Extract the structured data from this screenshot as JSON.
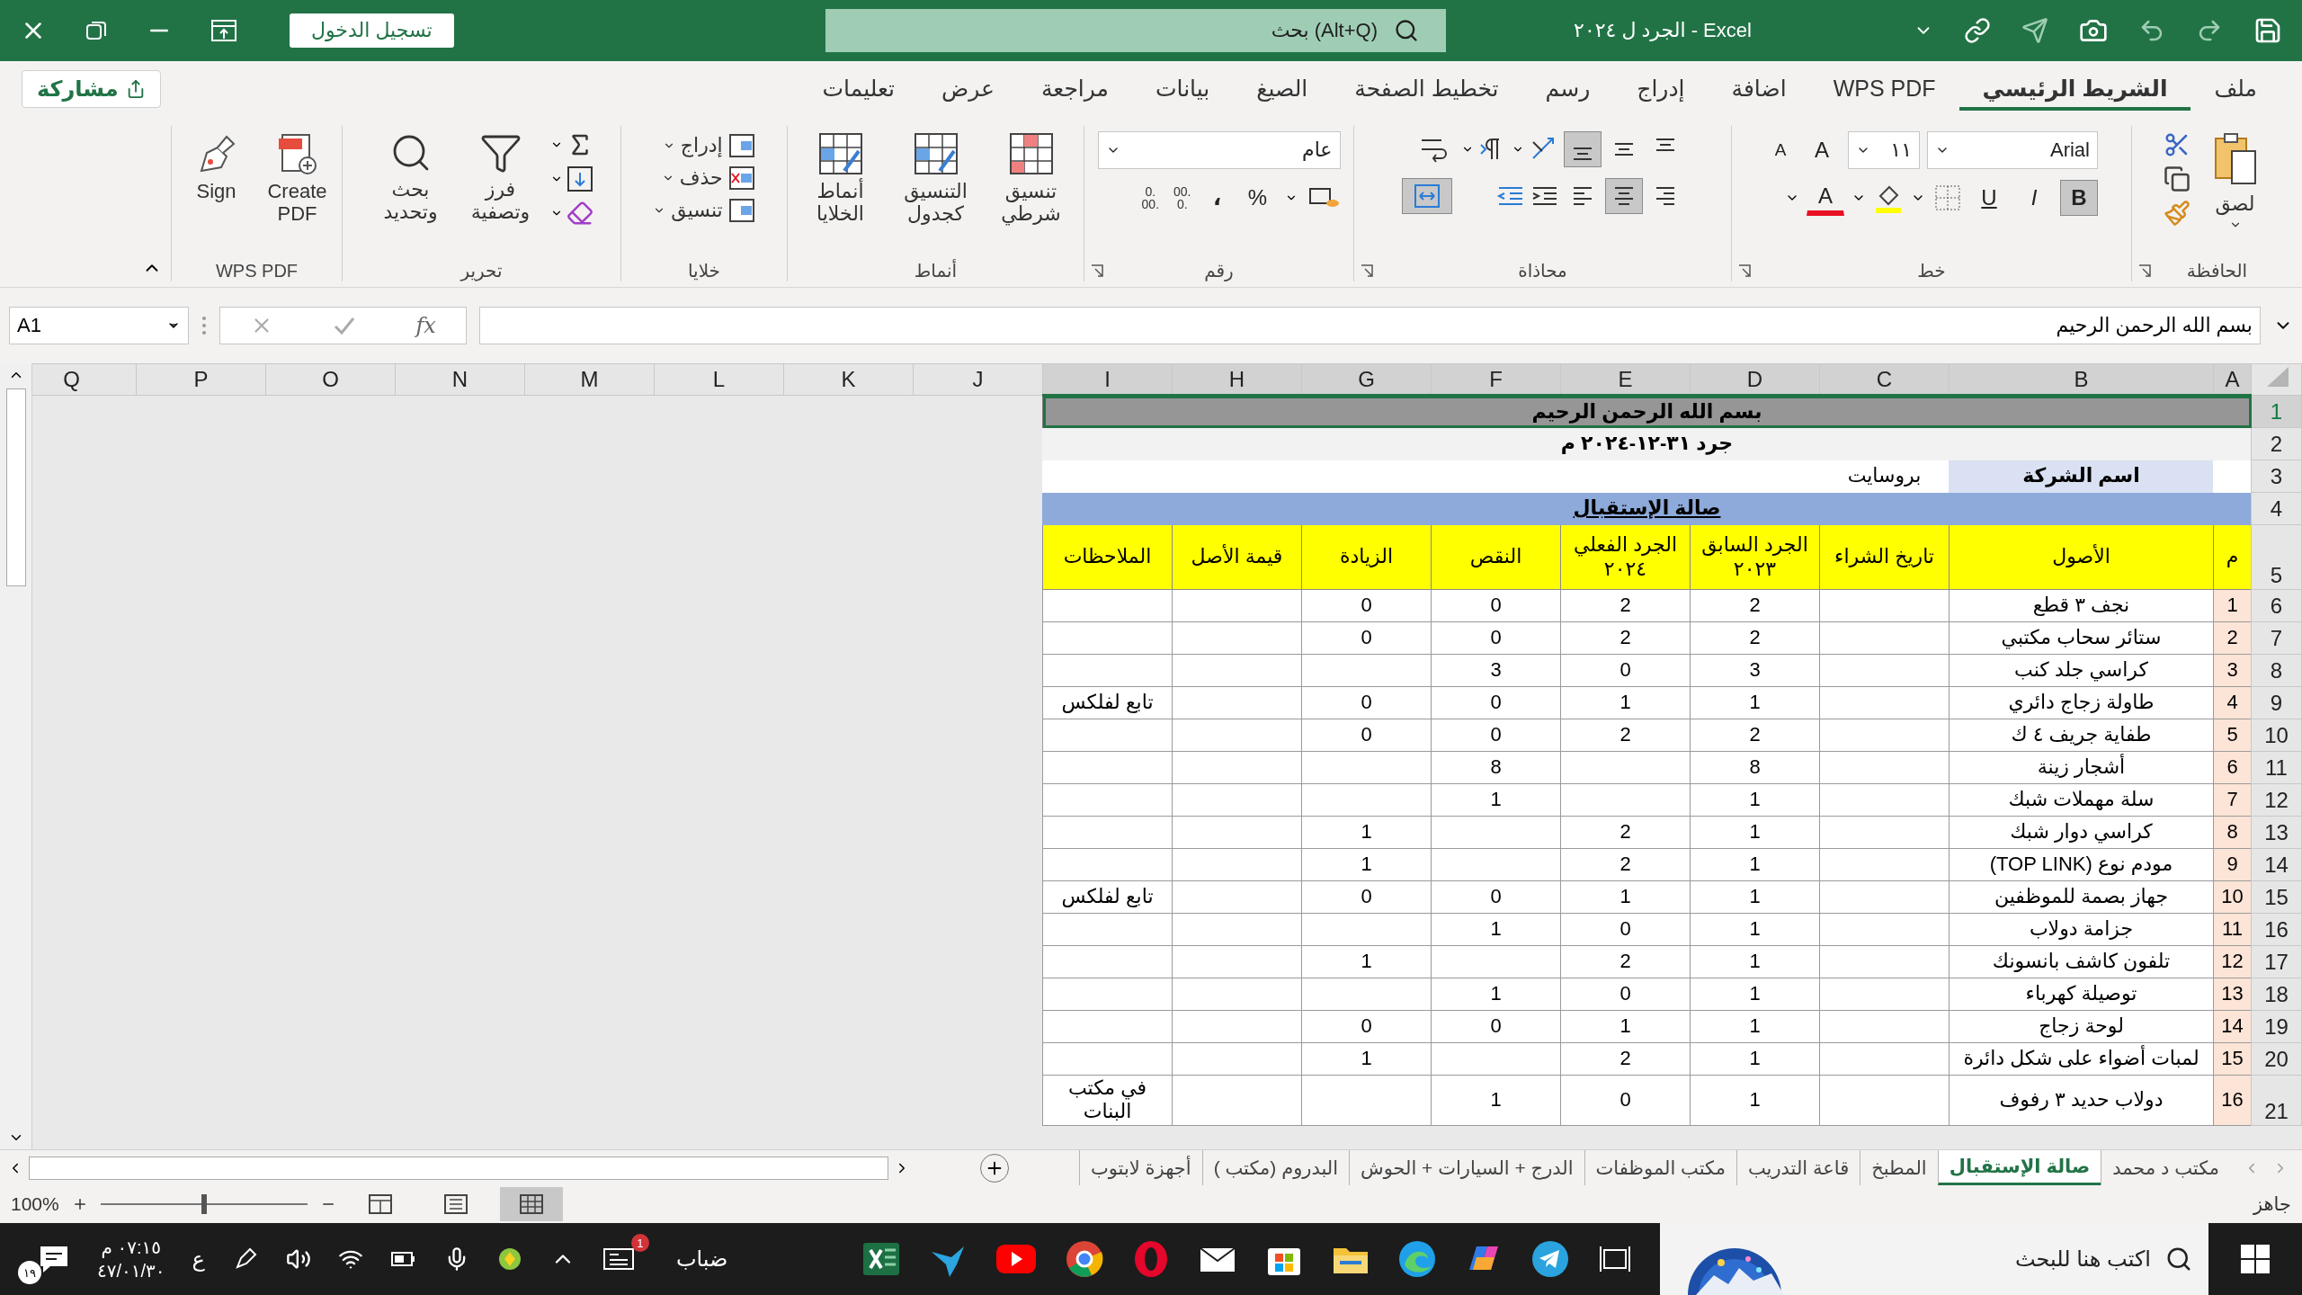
{
  "title_bar": {
    "sign_in": "تسجيل الدخول",
    "search_placeholder": "بحث (Alt+Q)",
    "document_title": "الجرد ل ٢٠٢٤  -  Excel"
  },
  "ribbon": {
    "share": "مشاركة",
    "tabs": [
      {
        "label": "ملف",
        "selected": false
      },
      {
        "label": "الشريط الرئيسي",
        "selected": true
      },
      {
        "label": "WPS PDF",
        "selected": false
      },
      {
        "label": "اضافة",
        "selected": false
      },
      {
        "label": "إدراج",
        "selected": false
      },
      {
        "label": "رسم",
        "selected": false
      },
      {
        "label": "تخطيط الصفحة",
        "selected": false
      },
      {
        "label": "الصيغ",
        "selected": false
      },
      {
        "label": "بيانات",
        "selected": false
      },
      {
        "label": "مراجعة",
        "selected": false
      },
      {
        "label": "عرض",
        "selected": false
      },
      {
        "label": "تعليمات",
        "selected": false
      }
    ],
    "clipboard": {
      "label": "الحافظة",
      "paste": "لصق"
    },
    "font": {
      "label": "خط",
      "name": "Arial",
      "size": "١١",
      "grow": "A",
      "shrink": "A",
      "color_glyph": "A",
      "styles": [
        {
          "label": "B",
          "selected": true
        },
        {
          "label": "I",
          "selected": false
        },
        {
          "label": "U",
          "selected": false
        }
      ]
    },
    "alignment": {
      "label": "محاذاة",
      "vertical": [
        {
          "selected": false
        },
        {
          "selected": false
        },
        {
          "selected": true
        }
      ],
      "horizontal": [
        {
          "selected": false
        },
        {
          "selected": true
        },
        {
          "selected": false
        }
      ],
      "merge_selected": true
    },
    "number": {
      "label": "رقم",
      "format": "عام",
      "percent": "%",
      "comma": "،",
      "decimals": [
        {
          "top": ".00",
          "bottom": ".0"
        },
        {
          "top": ".0",
          "bottom": ".00"
        }
      ]
    },
    "styles": {
      "label": "أنماط",
      "buttons": [
        "تنسيق شرطي",
        "التنسيق كجدول",
        "أنماط الخلايا"
      ]
    },
    "cells": {
      "label": "خلايا",
      "buttons": [
        "إدراج",
        "حذف",
        "تنسيق"
      ]
    },
    "editing": {
      "label": "تحرير",
      "buttons": [
        "فرز وتصفية",
        "بحث وتحديد"
      ]
    },
    "pdf": {
      "label": "WPS PDF",
      "buttons": [
        "Create PDF",
        "Sign"
      ]
    }
  },
  "formula_bar": {
    "name_box": "A1",
    "fx": "fx",
    "content": "بسم الله الرحمن الرحيم"
  },
  "sheet": {
    "columns": [
      {
        "label": "A",
        "selected": true
      },
      {
        "label": "B",
        "selected": true
      },
      {
        "label": "C",
        "selected": true
      },
      {
        "label": "D",
        "selected": true
      },
      {
        "label": "E",
        "selected": true
      },
      {
        "label": "F",
        "selected": true
      },
      {
        "label": "G",
        "selected": true
      },
      {
        "label": "H",
        "selected": true
      },
      {
        "label": "I",
        "selected": true
      },
      {
        "label": "J",
        "selected": false
      },
      {
        "label": "K",
        "selected": false
      },
      {
        "label": "L",
        "selected": false
      },
      {
        "label": "M",
        "selected": false
      },
      {
        "label": "N",
        "selected": false
      },
      {
        "label": "O",
        "selected": false
      },
      {
        "label": "P",
        "selected": false
      },
      {
        "label": "Q",
        "selected": false
      }
    ],
    "rows": [
      {
        "number": "1",
        "selected": true,
        "kind": "title",
        "text": "بسم الله الرحمن الرحيم"
      },
      {
        "number": "2",
        "selected": false,
        "kind": "subtitle",
        "text": "جرد ٣١-١٢-٢٠٢٤ م"
      },
      {
        "number": "3",
        "selected": false,
        "kind": "company",
        "label": "اسم الشركة",
        "value": "بروسايت"
      },
      {
        "number": "4",
        "selected": false,
        "kind": "section",
        "text": "صالة الإستقبال"
      },
      {
        "number": "5",
        "selected": false,
        "kind": "header",
        "cells": [
          "م",
          "الأصول",
          "تاريخ الشراء",
          "الجرد السابق ٢٠٢٣",
          "الجرد الفعلي ٢٠٢٤",
          "النقص",
          "الزيادة",
          "قيمة الأصل",
          "الملاحظات"
        ]
      },
      {
        "number": "6",
        "selected": false,
        "kind": "item",
        "cells": [
          "1",
          "نجف ٣ قطع",
          null,
          "2",
          "2",
          "0",
          "0",
          null,
          null
        ]
      },
      {
        "number": "7",
        "selected": false,
        "kind": "item",
        "cells": [
          "2",
          "ستائر سحاب مكتبي",
          null,
          "2",
          "2",
          "0",
          "0",
          null,
          null
        ]
      },
      {
        "number": "8",
        "selected": false,
        "kind": "item",
        "cells": [
          "3",
          "كراسي جلد كنب",
          null,
          "3",
          "0",
          "3",
          null,
          null,
          null
        ]
      },
      {
        "number": "9",
        "selected": false,
        "kind": "item",
        "cells": [
          "4",
          "طاولة زجاج دائري",
          null,
          "1",
          "1",
          "0",
          "0",
          null,
          "تابع لفلكس"
        ]
      },
      {
        "number": "10",
        "selected": false,
        "kind": "item",
        "cells": [
          "5",
          "طفاية جريف ٤ ك",
          null,
          "2",
          "2",
          "0",
          "0",
          null,
          null
        ]
      },
      {
        "number": "11",
        "selected": false,
        "kind": "item",
        "cells": [
          "6",
          "أشجار زينة",
          null,
          "8",
          null,
          "8",
          null,
          null,
          null
        ]
      },
      {
        "number": "12",
        "selected": false,
        "kind": "item",
        "cells": [
          "7",
          "سلة مهملات شبك",
          null,
          "1",
          null,
          "1",
          null,
          null,
          null
        ]
      },
      {
        "number": "13",
        "selected": false,
        "kind": "item",
        "cells": [
          "8",
          "كراسي دوار شبك",
          null,
          "1",
          "2",
          null,
          "1",
          null,
          null
        ]
      },
      {
        "number": "14",
        "selected": false,
        "kind": "item",
        "cells": [
          "9",
          "مودم نوع (TOP LINK)",
          null,
          "1",
          "2",
          null,
          "1",
          null,
          null
        ]
      },
      {
        "number": "15",
        "selected": false,
        "kind": "item",
        "cells": [
          "10",
          "جهاز بصمة للموظفين",
          null,
          "1",
          "1",
          "0",
          "0",
          null,
          "تابع لفلكس"
        ]
      },
      {
        "number": "16",
        "selected": false,
        "kind": "item",
        "cells": [
          "11",
          "جزامة دولاب",
          null,
          "1",
          "0",
          "1",
          null,
          null,
          null
        ]
      },
      {
        "number": "17",
        "selected": false,
        "kind": "item",
        "cells": [
          "12",
          "تلفون كاشف بانسونك",
          null,
          "1",
          "2",
          null,
          "1",
          null,
          null
        ]
      },
      {
        "number": "18",
        "selected": false,
        "kind": "item",
        "cells": [
          "13",
          "توصيلة كهرباء",
          null,
          "1",
          "0",
          "1",
          null,
          null,
          null
        ]
      },
      {
        "number": "19",
        "selected": false,
        "kind": "item",
        "cells": [
          "14",
          "لوحة زجاج",
          null,
          "1",
          "1",
          "0",
          "0",
          null,
          null
        ]
      },
      {
        "number": "20",
        "selected": false,
        "kind": "item",
        "cells": [
          "15",
          "لمبات أضواء على شكل دائرة",
          null,
          "1",
          "2",
          null,
          "1",
          null,
          null
        ]
      },
      {
        "number": "21",
        "selected": false,
        "kind": "item",
        "cells": [
          "16",
          "دولاب حديد ٣ رفوف",
          null,
          "1",
          "0",
          "1",
          null,
          null,
          "في مكتب البنات"
        ]
      }
    ]
  },
  "sheet_tabs": [
    {
      "label": "مكتب د محمد",
      "selected": false
    },
    {
      "label": "صالة الإستقبال",
      "selected": true
    },
    {
      "label": "المطبخ",
      "selected": false
    },
    {
      "label": "قاعة التدريب",
      "selected": false
    },
    {
      "label": "مكتب الموظفات",
      "selected": false
    },
    {
      "label": "الدرج + السيارات + الحوش",
      "selected": false
    },
    {
      "label": "البدروم (مكتب )",
      "selected": false
    },
    {
      "label": "أجهزة لابتوب",
      "selected": false
    }
  ],
  "status_bar": {
    "status": "جاهز",
    "zoom": "100%",
    "zoom_slider": {
      "level": 0.5
    },
    "views": [
      {
        "selected": false
      },
      {
        "selected": false
      },
      {
        "selected": true
      }
    ]
  },
  "taskbar": {
    "search_placeholder": "اكتب هنا للبحث",
    "weather": "ضباب",
    "news_badge": "1",
    "language": "ع",
    "time": "٠٧:١٥ م",
    "date": "٤٧/٠١/٣٠",
    "notifications": "١٩"
  }
}
